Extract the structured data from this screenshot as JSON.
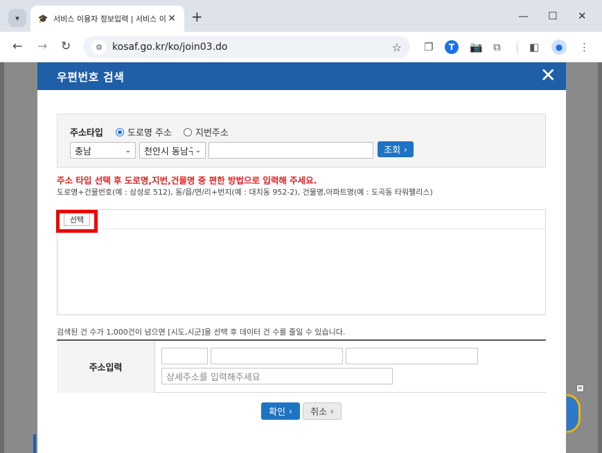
{
  "browser": {
    "tab_title": "서비스 이용자 정보입력 | 서비스 이용",
    "url": "kosaf.go.kr/ko/join03.do",
    "extension_t": "T"
  },
  "modal": {
    "title": "우편번호 검색",
    "search": {
      "address_type_label": "주소타입",
      "radio_road": "도로명 주소",
      "radio_lot": "지번주소",
      "selected_type": "도로명 주소",
      "province_select": "충남",
      "city_select": "천안시 동남구",
      "query_value": "",
      "search_button": "조회"
    },
    "warning": "주소 타입 선택 후 도로명,지번,건물명 중 편한 방법으로 입력해 주세요.",
    "hint": "도로명+건물번호(예 : 삼성로 512), 동/읍/면/리+번지(예 : 대치동 952-2), 건물명,아파트명(예 : 도곡동 타워팰리스)",
    "result": {
      "select_button": "선택"
    },
    "limit_note": "검색된 건 수가 1,000건이 넘으면 [시도,시군]을 선택 후 데이터 건 수를 줄일 수 있습니다.",
    "address_input": {
      "label": "주소입력",
      "postal_code": "",
      "road_address": "",
      "extra_address": "",
      "detail_placeholder": "상세주소를 입력해주세요"
    },
    "confirm_button": "확인",
    "cancel_button": "취소"
  },
  "colors": {
    "header_blue": "#1e5fa8",
    "button_blue": "#1f73c3",
    "warning_red": "#e02020",
    "highlight_red": "#ee0000"
  }
}
